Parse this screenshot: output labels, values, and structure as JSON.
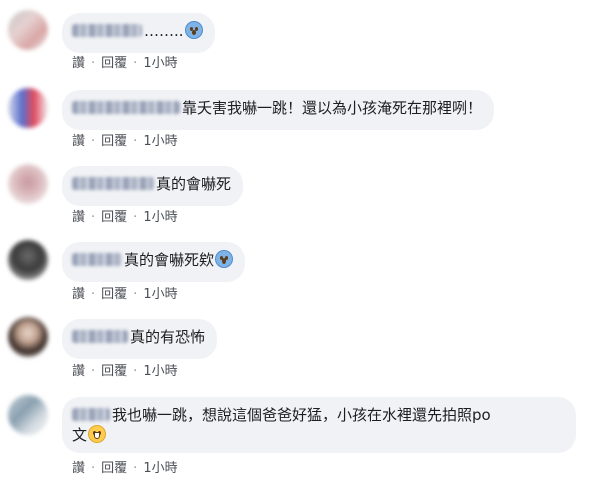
{
  "actions": {
    "like": "讚",
    "reply": "回覆",
    "separator": "·"
  },
  "comments": [
    {
      "text": "……..",
      "emoji": "fear-face-icon",
      "time": "1小時"
    },
    {
      "text": "靠夭害我嚇一跳！還以為小孩淹死在那裡咧！",
      "emoji": "",
      "time": "1小時"
    },
    {
      "text": "真的會嚇死",
      "emoji": "",
      "time": "1小時"
    },
    {
      "text": "真的會嚇死欸",
      "emoji": "scream-face-icon",
      "time": "1小時"
    },
    {
      "text": "真的有恐怖",
      "emoji": "",
      "time": "1小時"
    },
    {
      "text": "我也嚇一跳，想說這個爸爸好猛，小孩在水裡還先拍照po",
      "text2": "文",
      "emoji": "laughing-face-icon",
      "time": "1小時"
    }
  ]
}
